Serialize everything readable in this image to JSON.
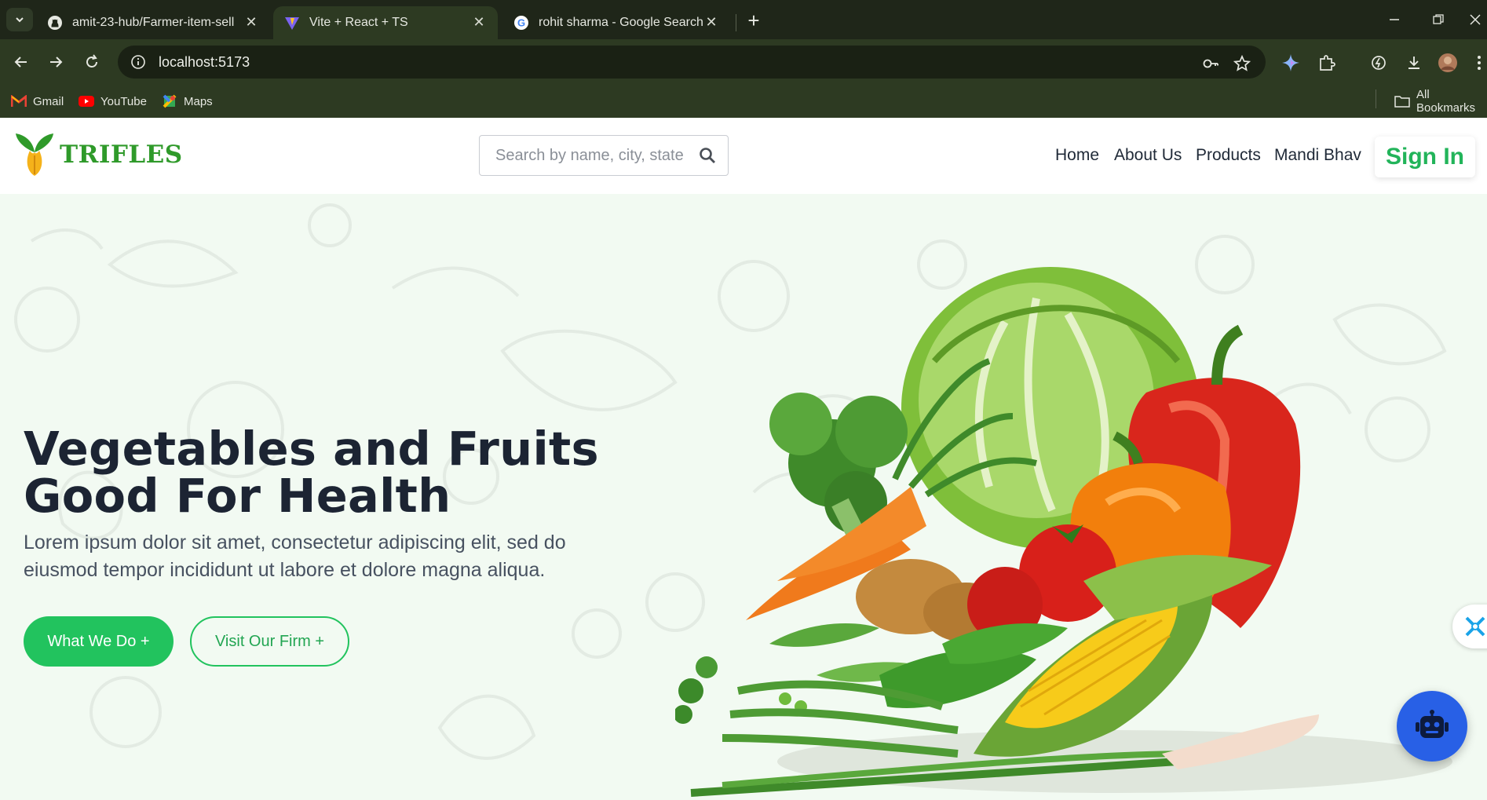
{
  "browser": {
    "tabs": [
      {
        "title": "amit-23-hub/Farmer-item-sell",
        "icon": "github-icon"
      },
      {
        "title": "Vite + React + TS",
        "icon": "vite-icon"
      },
      {
        "title": "rohit sharma - Google Search",
        "icon": "google-icon"
      }
    ],
    "url": "localhost:5173",
    "bookmarks": [
      {
        "label": "Gmail",
        "icon": "gmail-icon"
      },
      {
        "label": "YouTube",
        "icon": "youtube-icon"
      },
      {
        "label": "Maps",
        "icon": "maps-icon"
      }
    ],
    "all_bookmarks": "All Bookmarks"
  },
  "site": {
    "brand": "TRIFLES",
    "search_placeholder": "Search by name, city, state",
    "nav": [
      "Home",
      "About Us",
      "Products",
      "Mandi Bhav"
    ],
    "sign_in": "Sign In"
  },
  "hero": {
    "headline_line1": "Vegetables and Fruits",
    "headline_line2": "Good For Health",
    "subtitle": "Lorem ipsum dolor sit amet, consectetur adipiscing elit, sed do eiusmod tempor incididunt ut labore et dolore magna aliqua.",
    "primary_button": "What We Do +",
    "secondary_button": "Visit Our Firm +"
  },
  "colors": {
    "brand_green": "#22c35e",
    "logo_green": "#2f9a2a",
    "headline": "#1c2433",
    "chatbot_blue": "#2860e6"
  }
}
